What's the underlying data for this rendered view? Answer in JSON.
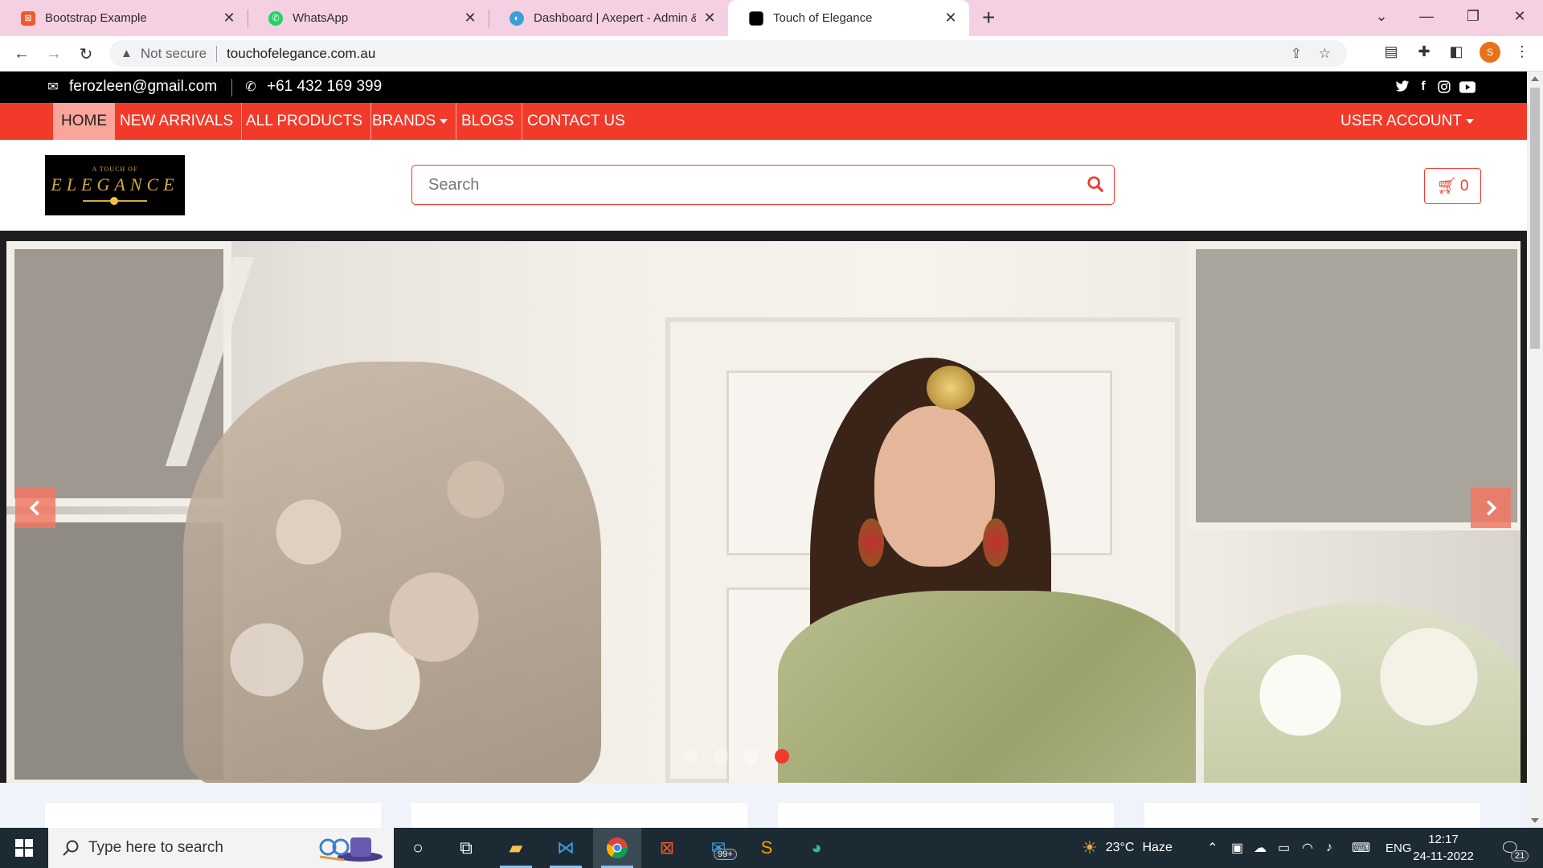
{
  "browser": {
    "tabs": [
      {
        "title": "Bootstrap Example",
        "icon": "bootstrap-example-favicon",
        "color": "#f05a28",
        "active": false
      },
      {
        "title": "WhatsApp",
        "icon": "whatsapp-favicon",
        "color": "#25d366",
        "active": false
      },
      {
        "title": "Dashboard | Axepert - Admin & D",
        "icon": "axepert-favicon",
        "color": "#3aa0d8",
        "active": false
      },
      {
        "title": "Touch of Elegance",
        "icon": "elegance-favicon",
        "color": "#000000",
        "active": true
      }
    ],
    "address": {
      "security_label": "Not secure",
      "url": "touchofelegance.com.au"
    },
    "profile_initial": "S"
  },
  "site": {
    "topbar": {
      "email": "ferozleen@gmail.com",
      "phone": "+61 432 169 399"
    },
    "nav": {
      "items": [
        {
          "label": "HOME",
          "active": true
        },
        {
          "label": "NEW ARRIVALS"
        },
        {
          "label": "ALL PRODUCTS"
        },
        {
          "label": "BRANDS",
          "dropdown": true
        },
        {
          "label": "BLOGS"
        },
        {
          "label": "CONTACT US"
        }
      ],
      "user_account": "USER ACCOUNT"
    },
    "logo": {
      "line1": "A TOUCH OF",
      "line2": "ELEGANCE"
    },
    "search": {
      "placeholder": "Search"
    },
    "cart": {
      "count": "0"
    },
    "carousel": {
      "slide_count": 4,
      "active_index": 3
    },
    "colors": {
      "brand_red": "#f23a2b",
      "active_nav_bg": "#f9a59c"
    }
  },
  "taskbar": {
    "search_placeholder": "Type here to search",
    "weather": {
      "temp": "23°C",
      "condition": "Haze"
    },
    "language": "ENG",
    "time": "12:17",
    "date": "24-11-2022",
    "mail_badge": "99+",
    "notification_count": "21"
  }
}
